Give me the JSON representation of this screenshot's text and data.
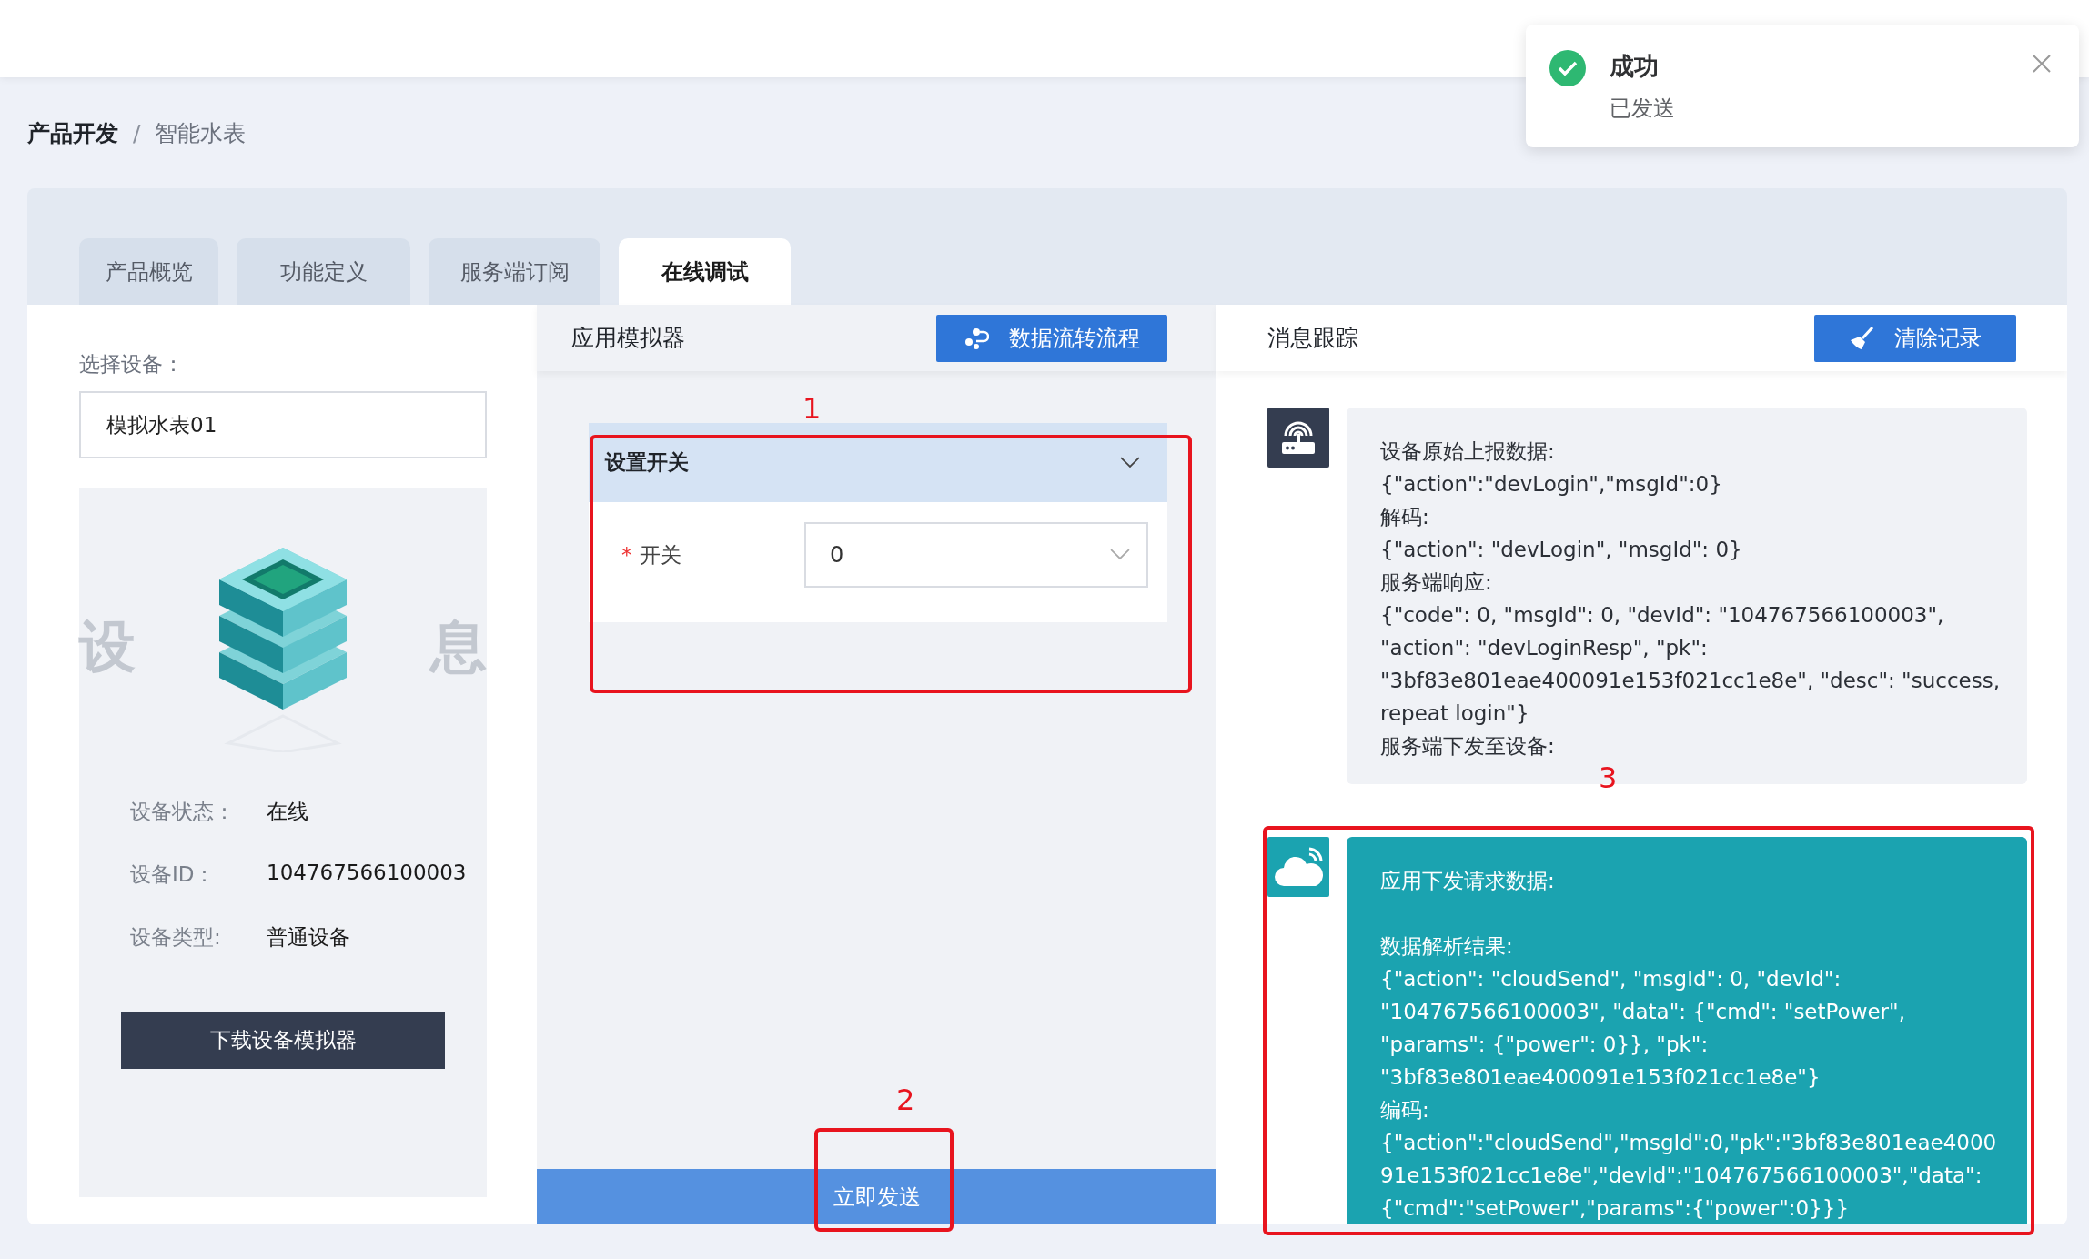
{
  "breadcrumb": {
    "parent": "产品开发",
    "separator": "/",
    "current": "智能水表"
  },
  "tabs": [
    {
      "label": "产品概览",
      "selected": false
    },
    {
      "label": "功能定义",
      "selected": false
    },
    {
      "label": "服务端订阅",
      "selected": false
    },
    {
      "label": "在线调试",
      "selected": true
    }
  ],
  "device_panel": {
    "label": "选择设备：",
    "device": "模拟水表01",
    "watermark": [
      "设",
      "息"
    ],
    "info": [
      {
        "label": "设备状态：",
        "value": "在线"
      },
      {
        "label": "设备ID：",
        "value": "104767566100003"
      },
      {
        "label": "设备类型:",
        "value": "普通设备"
      }
    ],
    "download_button": "下载设备模拟器"
  },
  "simulator": {
    "title": "应用模拟器",
    "flow_button": "数据流转流程",
    "section": {
      "title": "设置开关",
      "expanded": true,
      "fields": [
        {
          "label": "开关",
          "required": true,
          "required_mark": "*",
          "value": "0"
        }
      ]
    },
    "send_button": "立即发送"
  },
  "trace": {
    "title": "消息跟踪",
    "clear_button": "清除记录",
    "messages": [
      {
        "kind": "device",
        "sections": [
          [
            "设备原始上报数据:",
            "{\"action\":\"devLogin\",\"msgId\":0}",
            "解码:",
            "{\"action\": \"devLogin\", \"msgId\": 0}",
            "服务端响应:",
            "{\"code\": 0, \"msgId\": 0, \"devId\": \"104767566100003\", \"action\": \"devLoginResp\", \"pk\": \"3bf83e801eae400091e153f021cc1e8e\", \"desc\": \"success, repeat login\"}",
            "服务端下发至设备:"
          ]
        ]
      },
      {
        "kind": "cloud",
        "sections": [
          [
            "应用下发请求数据:"
          ],
          [
            "数据解析结果:",
            "{\"action\": \"cloudSend\", \"msgId\": 0, \"devId\": \"104767566100003\", \"data\": {\"cmd\": \"setPower\", \"params\": {\"power\": 0}}, \"pk\": \"3bf83e801eae400091e153f021cc1e8e\"}",
            "编码:",
            "{\"action\":\"cloudSend\",\"msgId\":0,\"pk\":\"3bf83e801eae400091e153f021cc1e8e\",\"devId\":\"104767566100003\",\"data\":{\"cmd\":\"setPower\",\"params\":{\"power\":0}}}"
          ]
        ]
      }
    ]
  },
  "toast": {
    "kind": "success",
    "title": "成功",
    "message": "已发送"
  },
  "annotations": [
    {
      "label": "1"
    },
    {
      "label": "2"
    },
    {
      "label": "3"
    }
  ]
}
